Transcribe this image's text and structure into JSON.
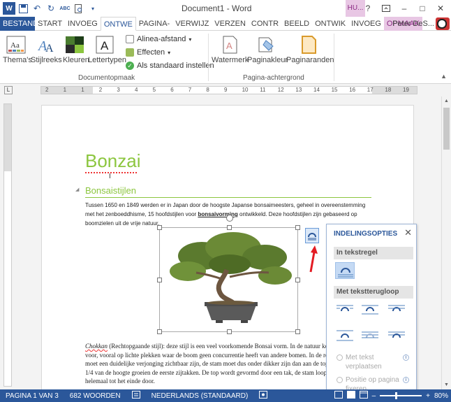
{
  "window": {
    "title": "Document1 - Word",
    "contextual_tab": "HU...",
    "minimize_glyph": "–",
    "maximize_glyph": "□",
    "close_glyph": "✕",
    "help_glyph": "?"
  },
  "quick_access": {
    "word_glyph": "W",
    "save_glyph": "💾",
    "undo_glyph": "↶",
    "redo_glyph": "↻",
    "spell_glyph": "ABC",
    "preview_glyph": "🔍"
  },
  "tabs": [
    {
      "label": "BESTAND"
    },
    {
      "label": "START"
    },
    {
      "label": "INVOEG"
    },
    {
      "label": "ONTWE"
    },
    {
      "label": "PAGINA-"
    },
    {
      "label": "VERWIJZ"
    },
    {
      "label": "VERZEN"
    },
    {
      "label": "CONTR"
    },
    {
      "label": "BEELD"
    },
    {
      "label": "ONTWIK"
    },
    {
      "label": "INVOEG"
    },
    {
      "label": "OPMAAK"
    }
  ],
  "user_name": "Peter DeS...",
  "ribbon": {
    "themes_label": "Thema's",
    "stijlreeks_label": "Stijlreeks",
    "kleuren_label": "Kleuren",
    "lettertypen_label": "Lettertypen",
    "alinea_label": "Alinea-afstand",
    "effecten_label": "Effecten",
    "standaard_label": "Als standaard instellen",
    "documentopmaak_label": "Documentopmaak",
    "watermerk_label": "Watermerk",
    "paginakleur_label": "Paginakleur",
    "paginaranden_label": "Paginaranden",
    "pagina_achtergrond_label": "Pagina-achtergrond"
  },
  "ruler": {
    "tab_selector": "L",
    "numbers": [
      "2",
      "1",
      "1",
      "2",
      "3",
      "4",
      "5",
      "6",
      "7",
      "8",
      "9",
      "10",
      "11",
      "12",
      "13",
      "14",
      "15",
      "16",
      "17",
      "18",
      "19"
    ]
  },
  "document": {
    "title": "Bonzai",
    "heading": "Bonsaistijlen",
    "para1_a": "Tussen 1650 en 1849 werden er in Japan door de hoogste Japanse bonsaimeesters, geheel in overeenstemming met het zenboeddhisme, 15 hoofdstijlen voor ",
    "para1_bold": "bonsaivorming",
    "para1_b": " ontwikkeld. Deze hoofdstijlen zijn gebaseerd op boomzielen uit de vrije natuur.",
    "para2_italic": "Chokkan",
    "para2": " (Rechtopgaande stijl): deze stijl is een veel voorkomende Bonsai vorm. In de natuur komt deze stijl veel voor, vooral op lichte plekken waar de boom geen concurrentie heeft van andere bomen. In de recht lopende stam moet een duidelijke verjonging zichtbaar zijn, de stam moet dus onder dikker zijn dan aan de top. Op ongeveer 1/4 van de hoogte groeien de eerste zijtakken. De top wordt gevormd door een tak, de stam loopt dus niet helemaal tot het einde door."
  },
  "layout_options": {
    "title": "INDELINGSOPTIES",
    "in_tekstregel": "In tekstregel",
    "met_tekstterugloop": "Met tekstterugloop",
    "radio1": "Met tekst verplaatsen",
    "radio2": "Positie op pagina fixeren",
    "info_glyph": "i"
  },
  "status": {
    "page": "PAGINA 1 VAN 3",
    "words": "682 WOORDEN",
    "language": "NEDERLANDS (STANDAARD)",
    "zoom": "80%"
  }
}
